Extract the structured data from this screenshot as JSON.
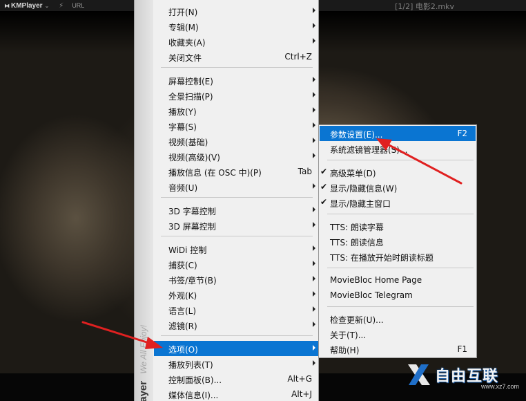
{
  "titlebar": {
    "app_name": "KMPlayer",
    "url_label": "URL",
    "filename": "[1/2] 电影2.mkv"
  },
  "sidebar_strip": {
    "brand": "ayer",
    "tagline": "We All Enjoy!"
  },
  "main_menu": {
    "items": [
      {
        "label": "打开(N)",
        "shortcut": "",
        "submenu": true,
        "highlighted": false
      },
      {
        "label": "专辑(M)",
        "shortcut": "",
        "submenu": true,
        "highlighted": false
      },
      {
        "label": "收藏夹(A)",
        "shortcut": "",
        "submenu": true,
        "highlighted": false
      },
      {
        "label": "关闭文件",
        "shortcut": "Ctrl+Z",
        "submenu": false,
        "highlighted": false
      },
      {
        "label": "屏幕控制(E)",
        "shortcut": "",
        "submenu": true,
        "highlighted": false
      },
      {
        "label": "全景扫描(P)",
        "shortcut": "",
        "submenu": true,
        "highlighted": false
      },
      {
        "label": "播放(Y)",
        "shortcut": "",
        "submenu": true,
        "highlighted": false
      },
      {
        "label": "字幕(S)",
        "shortcut": "",
        "submenu": true,
        "highlighted": false
      },
      {
        "label": "视频(基础)",
        "shortcut": "",
        "submenu": true,
        "highlighted": false
      },
      {
        "label": "视频(高级)(V)",
        "shortcut": "",
        "submenu": true,
        "highlighted": false
      },
      {
        "label": "播放信息 (在 OSC 中)(P)",
        "shortcut": "Tab",
        "submenu": false,
        "highlighted": false
      },
      {
        "label": "音频(U)",
        "shortcut": "",
        "submenu": true,
        "highlighted": false
      },
      {
        "label": "3D 字幕控制",
        "shortcut": "",
        "submenu": true,
        "highlighted": false
      },
      {
        "label": "3D 屏幕控制",
        "shortcut": "",
        "submenu": true,
        "highlighted": false
      },
      {
        "label": "WiDi 控制",
        "shortcut": "",
        "submenu": true,
        "highlighted": false
      },
      {
        "label": "捕获(C)",
        "shortcut": "",
        "submenu": true,
        "highlighted": false
      },
      {
        "label": "书签/章节(B)",
        "shortcut": "",
        "submenu": true,
        "highlighted": false
      },
      {
        "label": "外观(K)",
        "shortcut": "",
        "submenu": true,
        "highlighted": false
      },
      {
        "label": "语言(L)",
        "shortcut": "",
        "submenu": true,
        "highlighted": false
      },
      {
        "label": "滤镜(R)",
        "shortcut": "",
        "submenu": true,
        "highlighted": false
      },
      {
        "label": "选项(O)",
        "shortcut": "",
        "submenu": true,
        "highlighted": true
      },
      {
        "label": "播放列表(T)",
        "shortcut": "",
        "submenu": true,
        "highlighted": false
      },
      {
        "label": "控制面板(B)...",
        "shortcut": "Alt+G",
        "submenu": false,
        "highlighted": false
      },
      {
        "label": "媒体信息(I)...",
        "shortcut": "Alt+J",
        "submenu": false,
        "highlighted": false
      }
    ]
  },
  "options_submenu": {
    "items": [
      {
        "label": "参数设置(E)...",
        "shortcut": "F2",
        "checked": false,
        "highlighted": true
      },
      {
        "label": "系统滤镜管理器(S)...",
        "shortcut": "",
        "checked": false,
        "highlighted": false
      },
      {
        "label": "高级菜单(D)",
        "shortcut": "",
        "checked": true,
        "highlighted": false
      },
      {
        "label": "显示/隐藏信息(W)",
        "shortcut": "",
        "checked": true,
        "highlighted": false
      },
      {
        "label": "显示/隐藏主窗口",
        "shortcut": "",
        "checked": true,
        "highlighted": false
      },
      {
        "label": "TTS: 朗读字幕",
        "shortcut": "",
        "checked": false,
        "highlighted": false
      },
      {
        "label": "TTS: 朗读信息",
        "shortcut": "",
        "checked": false,
        "highlighted": false
      },
      {
        "label": "TTS: 在播放开始时朗读标题",
        "shortcut": "",
        "checked": false,
        "highlighted": false
      },
      {
        "label": "MovieBloc Home Page",
        "shortcut": "",
        "checked": false,
        "highlighted": false
      },
      {
        "label": "MovieBloc Telegram",
        "shortcut": "",
        "checked": false,
        "highlighted": false
      },
      {
        "label": "检查更新(U)...",
        "shortcut": "",
        "checked": false,
        "highlighted": false
      },
      {
        "label": "关于(T)...",
        "shortcut": "",
        "checked": false,
        "highlighted": false
      },
      {
        "label": "帮助(H)",
        "shortcut": "F1",
        "checked": false,
        "highlighted": false
      }
    ]
  },
  "watermark": {
    "text": "自由互联",
    "subtext": "www.xz7.com"
  },
  "colors": {
    "highlight": "#0a75d2",
    "annotation_arrow": "#e02020",
    "menu_bg": "#f0f0f0"
  }
}
